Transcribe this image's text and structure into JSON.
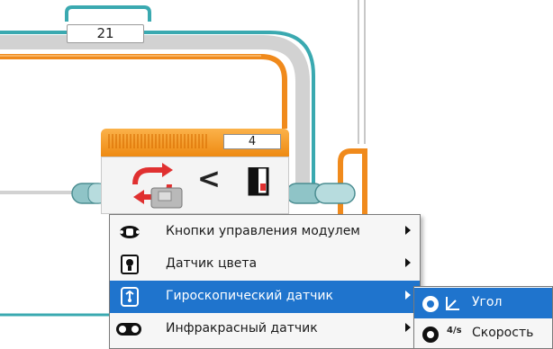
{
  "loop": {
    "label": "21"
  },
  "block": {
    "port_value": "4",
    "compare_symbol": "<"
  },
  "menu": {
    "items": [
      {
        "label": "Кнопки управления модулем",
        "icon": "brick-buttons-icon",
        "active": false
      },
      {
        "label": "Датчик цвета",
        "icon": "color-sensor-icon",
        "active": false
      },
      {
        "label": "Гироскопический датчик",
        "icon": "gyro-sensor-icon",
        "active": true
      },
      {
        "label": "Инфракрасный датчик",
        "icon": "infrared-sensor-icon",
        "active": false
      }
    ]
  },
  "submenu": {
    "items": [
      {
        "label": "Угол",
        "glyph": "",
        "icon": "angle-icon",
        "active": true
      },
      {
        "label": "Скорость",
        "glyph": "4/s",
        "icon": "rate-icon",
        "active": false
      }
    ]
  },
  "colors": {
    "wire_orange": "#f08a1c",
    "wire_gray": "#c8c8c8",
    "wire_teal": "#3aa9b0",
    "selection_blue": "#1f74cd"
  }
}
